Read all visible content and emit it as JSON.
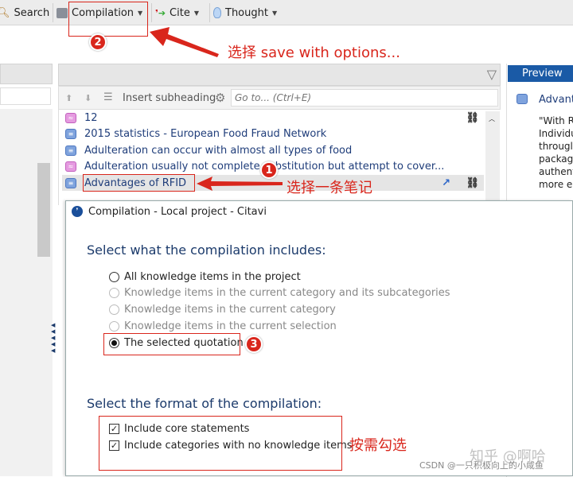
{
  "toolbar": {
    "search": "Search",
    "compilation": "Compilation",
    "cite": "Cite",
    "thought": "Thought"
  },
  "middle": {
    "insert_subheading": "Insert subheading",
    "goto_placeholder": "Go to... (Ctrl+E)",
    "items": [
      {
        "label": "12",
        "icon": "thought",
        "link": true,
        "jump": false
      },
      {
        "label": "2015 statistics - European Food Fraud Network",
        "icon": "quotation",
        "link": false,
        "jump": false
      },
      {
        "label": "Adulteration can occur with almost all types of food",
        "icon": "quotation",
        "link": false,
        "jump": false
      },
      {
        "label": "Adulteration usually not complete substitution but attempt to cover...",
        "icon": "thought",
        "link": false,
        "jump": false
      },
      {
        "label": "Advantages of RFID",
        "icon": "quotation",
        "link": true,
        "jump": true,
        "selected": true
      }
    ]
  },
  "preview": {
    "tab": "Preview",
    "title": "Advant",
    "lines": [
      "\"With R",
      "Individu",
      "througl",
      "packag",
      "authent",
      "more e"
    ]
  },
  "dialog": {
    "title": "Compilation - Local project - Citavi",
    "section1": "Select what the compilation includes:",
    "options": [
      {
        "label": "All knowledge items in the project",
        "enabled": true,
        "checked": false
      },
      {
        "label": "Knowledge items in the current category and its subcategories",
        "enabled": false,
        "checked": false
      },
      {
        "label": "Knowledge items in the current category",
        "enabled": false,
        "checked": false
      },
      {
        "label": "Knowledge items in the current selection",
        "enabled": false,
        "checked": false
      },
      {
        "label": "The selected quotation",
        "enabled": true,
        "checked": true
      }
    ],
    "section2": "Select the format of the compilation:",
    "checks": [
      {
        "label": "Include core statements",
        "checked": true
      },
      {
        "label": "Include categories with no knowledge items",
        "checked": true
      }
    ]
  },
  "annotations": {
    "step1": "1",
    "step2": "2",
    "step3": "3",
    "note1": "选择一条笔记",
    "note2": "选择 save with options...",
    "note3": "按需勾选",
    "color": "#d9261c"
  },
  "watermark": {
    "zhihu": "知乎 @啊哈",
    "csdn": "CSDN @一只积极向上的小咸鱼"
  }
}
